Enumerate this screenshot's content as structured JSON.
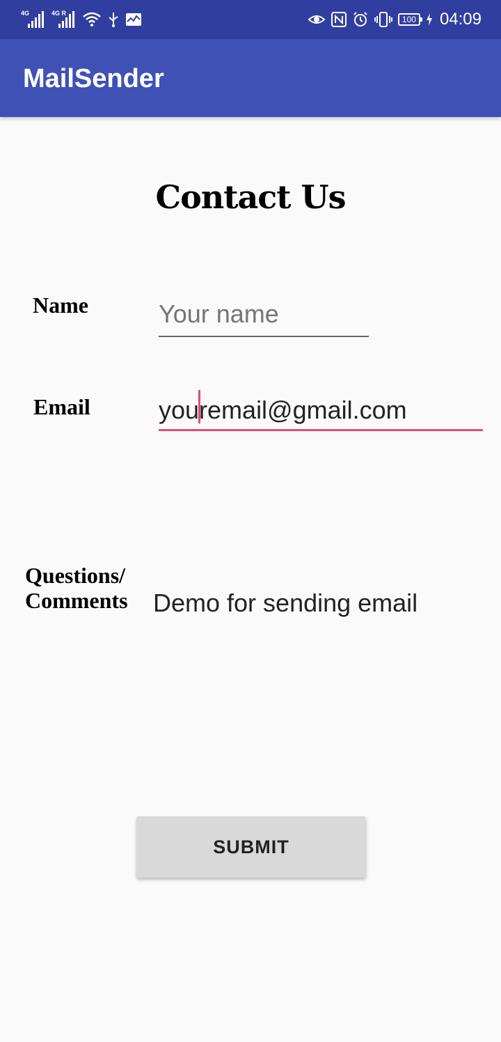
{
  "status_bar": {
    "network_1": "4G",
    "network_2": "4G R",
    "battery": "100",
    "time": "04:09",
    "icons": [
      "signal-icon",
      "signal-icon",
      "wifi-icon",
      "usb-icon",
      "activity-icon",
      "eye-icon",
      "nfc-icon",
      "alarm-icon",
      "vibrate-icon",
      "battery-icon",
      "charging-icon"
    ]
  },
  "app_bar": {
    "title": "MailSender"
  },
  "page": {
    "title": "Contact Us"
  },
  "form": {
    "name_label": "Name",
    "name_placeholder": "Your name",
    "name_value": "",
    "email_label": "Email",
    "email_value": "youremail@gmail.com",
    "questions_label_line1": "Questions/",
    "questions_label_line2": "Comments",
    "comments_value": "Demo for sending email"
  },
  "submit_label": "SUBMIT",
  "colors": {
    "status_bar": "#303f9f",
    "app_bar": "#3f51b5",
    "accent": "#e0497a",
    "background": "#fafafa",
    "button": "#d8d9d8"
  }
}
